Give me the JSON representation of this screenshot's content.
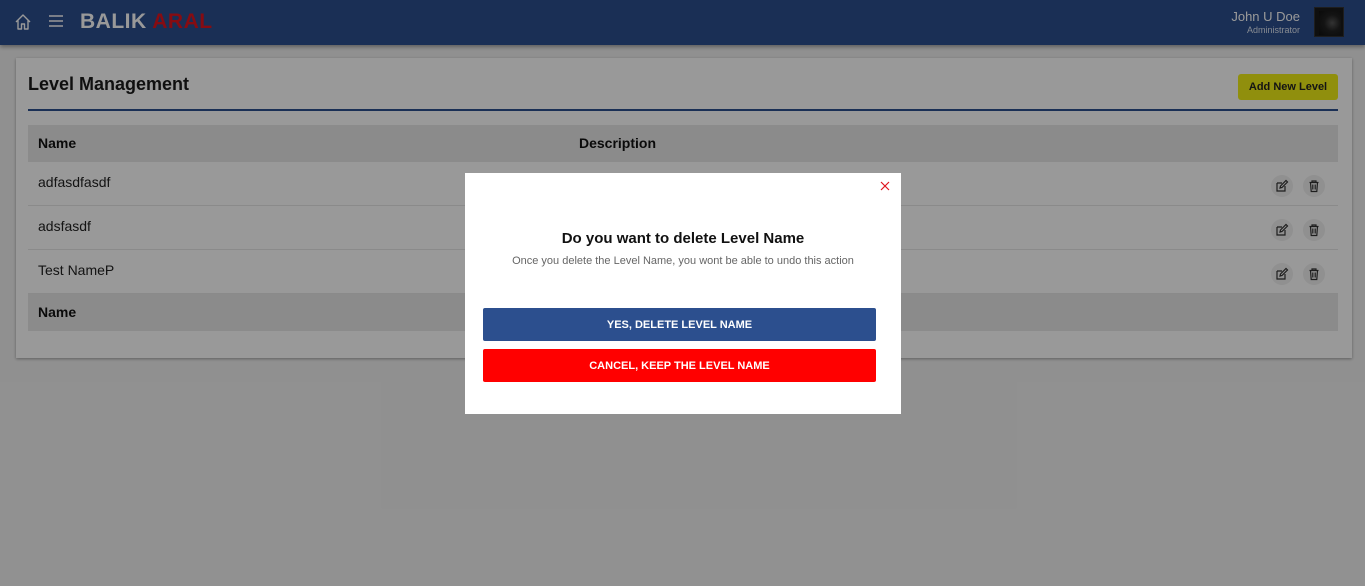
{
  "header": {
    "brand_part1": "BALIK",
    "brand_part2": "ARAL",
    "user_name": "John U Doe",
    "user_role": "Administrator",
    "home_icon": "home-icon",
    "menu_icon": "hamburger-menu-icon"
  },
  "page": {
    "title": "Level Management",
    "add_button": "Add New Level"
  },
  "table": {
    "columns": [
      "Name",
      "Description"
    ],
    "rows": [
      {
        "name": "adfasdfasdf",
        "description": ""
      },
      {
        "name": "adsfasdf",
        "description": ""
      },
      {
        "name": "Test NameP",
        "description": ""
      }
    ],
    "footer_columns": [
      "Name"
    ]
  },
  "modal": {
    "title": "Do you want to delete Level Name",
    "subtitle": "Once you delete the Level Name, you wont be able to undo this action",
    "confirm_label": "YES, DELETE LEVEL NAME",
    "cancel_label": "CANCEL, KEEP THE LEVEL NAME"
  },
  "colors": {
    "primary": "#2c4f8e",
    "accent_yellow": "#f1ee16",
    "danger": "#ff0000",
    "brand_red": "#e0141e"
  }
}
